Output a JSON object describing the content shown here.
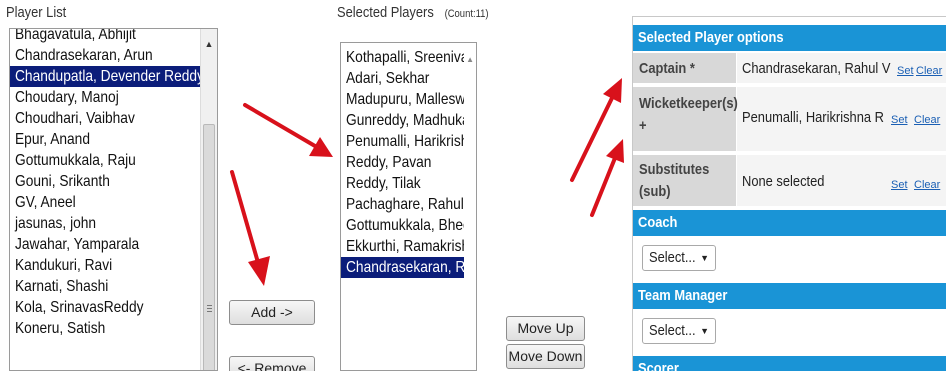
{
  "player_list": {
    "title": "Player List",
    "items": [
      "Bhagavatula, Abhijit",
      "Chandrasekaran, Arun",
      "Chandupatla, Devender Reddy",
      "Choudary, Manoj",
      "Choudhari, Vaibhav",
      "Epur, Anand",
      "Gottumukkala, Raju",
      "Gouni, Srikanth",
      "GV, Aneel",
      "jasunas, john",
      "Jawahar, Yamparala",
      "Kandukuri, Ravi",
      "Karnati, Shashi",
      "Kola, SrinavasReddy",
      "Koneru, Satish"
    ],
    "selected_item": "Chandupatla, Devender Reddy"
  },
  "selected_players": {
    "title": "Selected Players",
    "count_label": "(Count:11)",
    "items": [
      "Kothapalli, Sreenivas",
      "Adari, Sekhar",
      "Madupuru, Malleswara",
      "Gunreddy, Madhukar",
      "Penumalli, Harikrishna",
      "Reddy, Pavan",
      "Reddy, Tilak",
      "Pachaghare, Rahul V",
      "Gottumukkala, Bheema",
      "Ekkurthi, Ramakrishna",
      "Chandrasekaran, Rahu"
    ],
    "selected_item": "Chandrasekaran, Rahu"
  },
  "buttons": {
    "add": "Add ->",
    "remove": "<- Remove",
    "move_up": "Move Up",
    "move_down": "Move Down"
  },
  "options_panel": {
    "header": "Selected Player options",
    "captain": {
      "label": "Captain *",
      "value": "Chandrasekaran, Rahul V",
      "set": "Set",
      "clear": "Clear"
    },
    "wicketkeeper": {
      "label_line1": "Wicketkeeper(s)",
      "label_line2": "+",
      "value": "Penumalli, Harikrishna R",
      "set": "Set",
      "clear": "Clear"
    },
    "substitutes": {
      "label_line1": "Substitutes",
      "label_line2": "(sub)",
      "value": "None selected",
      "set": "Set",
      "clear": "Clear"
    },
    "coach": {
      "header": "Coach",
      "select_value": "Select..."
    },
    "team_manager": {
      "header": "Team Manager",
      "select_value": "Select..."
    },
    "scorer": {
      "header": "Scorer"
    }
  },
  "colors": {
    "accent_header": "#1a94d6",
    "list_selection": "#0b1d7a",
    "annotation_arrow": "#d8111b",
    "link": "#1a5fb4"
  }
}
